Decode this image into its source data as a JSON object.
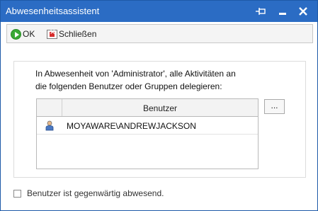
{
  "window": {
    "title": "Abwesenheitsassistent",
    "accent_color": "#2b6cc4"
  },
  "titlebar_buttons": {
    "pin_icon": "pin-icon",
    "minimize_icon": "minimize-icon",
    "close_icon": "close-icon"
  },
  "toolbar": {
    "ok_label": "OK",
    "ok_icon": "play-circle-icon",
    "close_label": "Schließen",
    "close_icon": "close-window-icon"
  },
  "delegation": {
    "description_line1": "In Abwesenheit von 'Administrator', alle Aktivitäten an",
    "description_line2": "die folgenden Benutzer oder Gruppen delegieren:",
    "column_header": "Benutzer",
    "browse_label": "...",
    "rows": [
      {
        "icon": "user-icon",
        "name": "MOYAWARE\\ANDREWJACKSON"
      }
    ]
  },
  "absent_checkbox": {
    "label": "Benutzer ist gegenwärtig abwesend.",
    "checked": false
  }
}
